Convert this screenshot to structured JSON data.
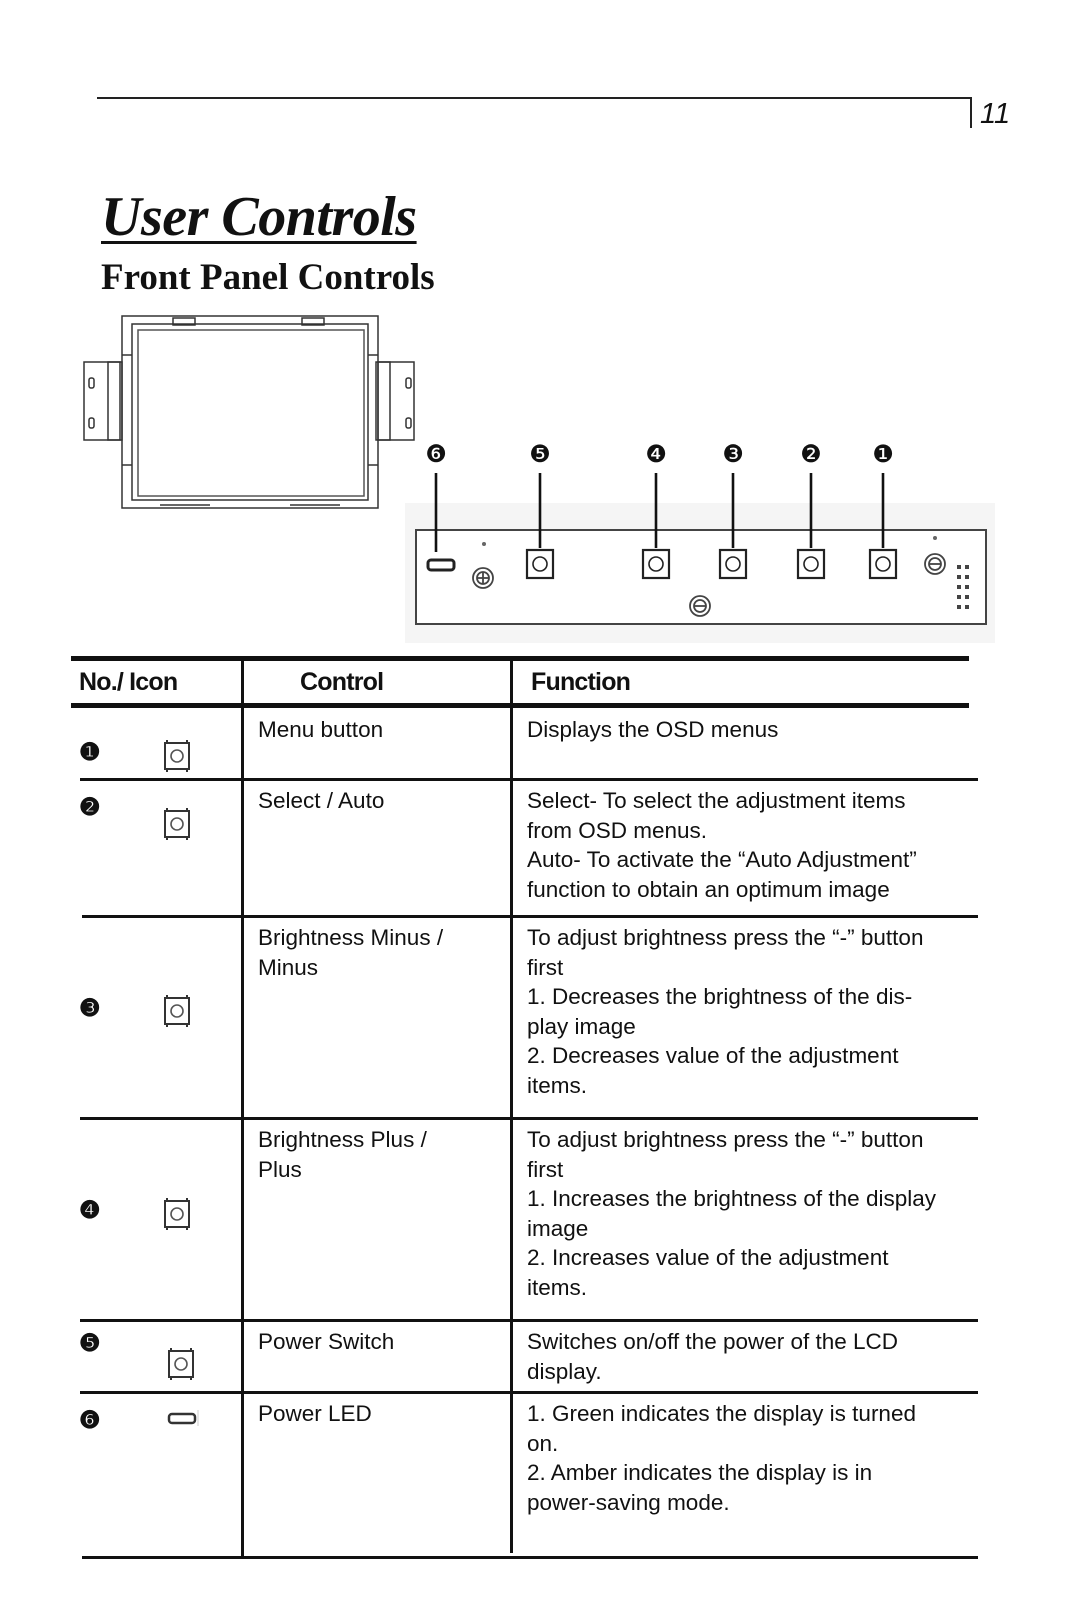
{
  "page": {
    "number": "11",
    "title": "User Controls",
    "subtitle": "Front Panel Controls"
  },
  "diagram": {
    "callouts": [
      "6",
      "5",
      "4",
      "3",
      "2",
      "1"
    ],
    "callout_glyphs": [
      "❻",
      "❺",
      "❹",
      "❸",
      "❷",
      "❶"
    ]
  },
  "table": {
    "headers": {
      "no_icon": "No./ Icon",
      "control": "Control",
      "function": "Function"
    },
    "rows": [
      {
        "no": "❶",
        "icon": "push-button-icon",
        "control": "Menu button",
        "function": "Displays the OSD menus"
      },
      {
        "no": "❷",
        "icon": "push-button-icon",
        "control": "Select / Auto",
        "function": "Select- To select the adjustment items\nfrom OSD menus.\nAuto- To activate the “Auto Adjustment”\nfunction to obtain an optimum image"
      },
      {
        "no": "❸",
        "icon": "push-button-icon",
        "control": "Brightness Minus /\nMinus",
        "function": "To adjust brightness press the “-” button\nfirst\n1. Decreases the brightness of the dis-\nplay image\n2. Decreases value of the adjustment\nitems."
      },
      {
        "no": "❹",
        "icon": "push-button-icon",
        "control": "Brightness Plus /\nPlus",
        "function": "To adjust brightness press the “-” button\nfirst\n1. Increases the brightness of the display\nimage\n2. Increases value of the adjustment\nitems."
      },
      {
        "no": "❺",
        "icon": "push-button-icon",
        "control": "Power Switch",
        "function": "Switches on/off the power of the LCD\ndisplay."
      },
      {
        "no": "❻",
        "icon": "led-icon",
        "control": "Power LED",
        "function": "1. Green indicates the display is turned\non.\n2. Amber indicates the display is in\npower-saving mode."
      }
    ]
  }
}
